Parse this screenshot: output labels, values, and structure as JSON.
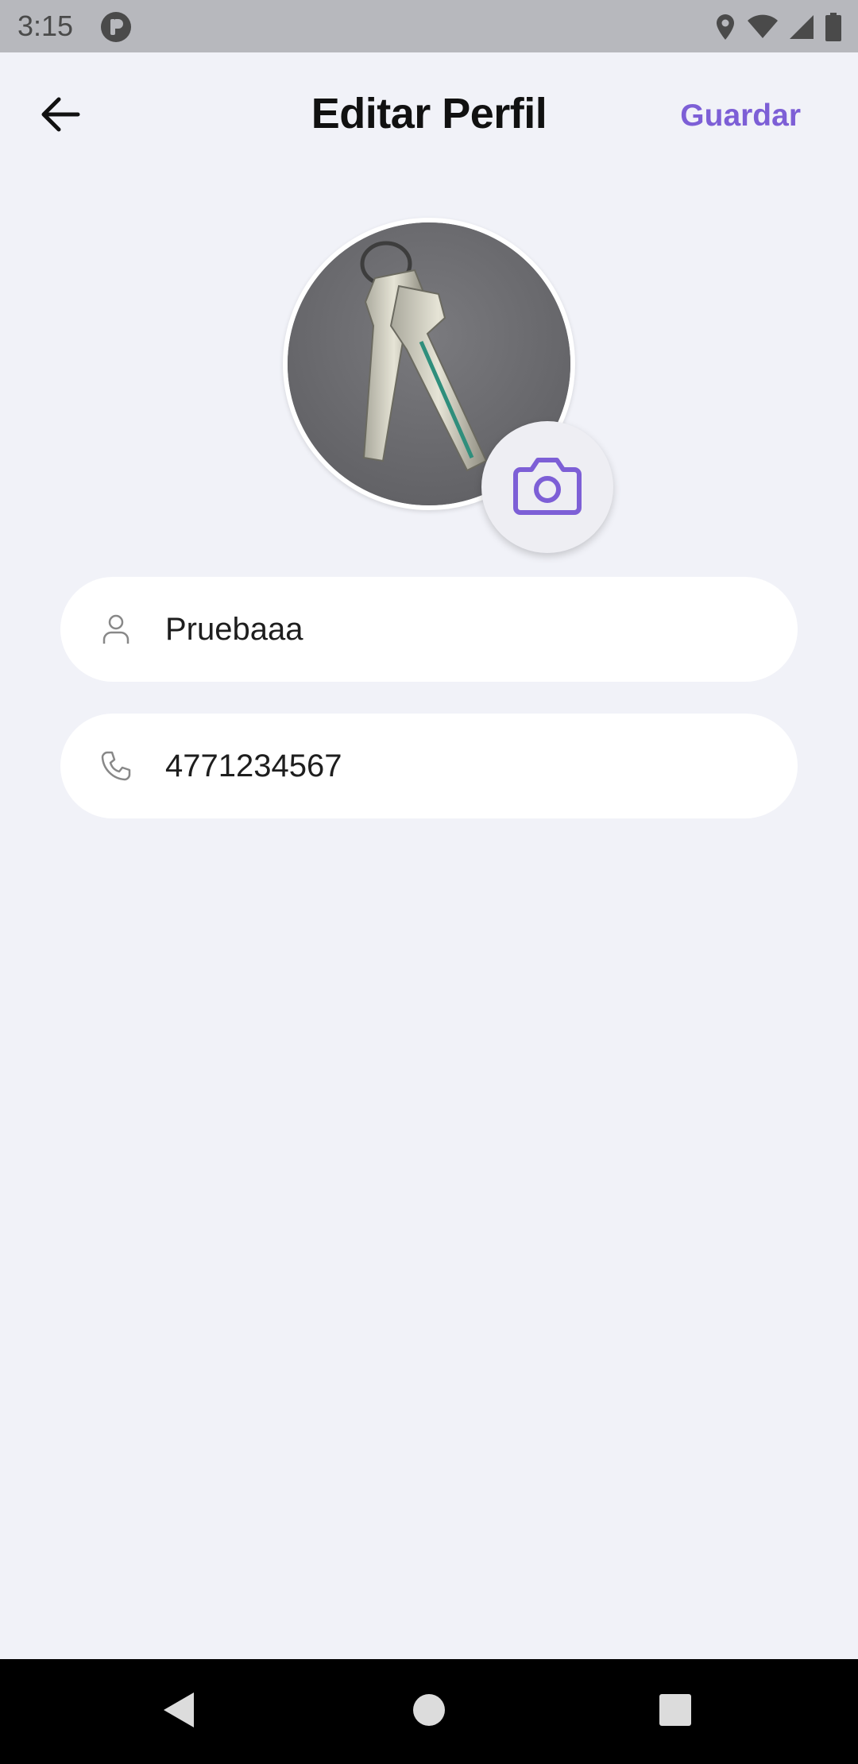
{
  "status_bar": {
    "time": "3:15",
    "icons": [
      "app-notification-icon",
      "location-icon",
      "wifi-icon",
      "signal-icon",
      "battery-icon"
    ]
  },
  "header": {
    "title": "Editar Perfil",
    "save_label": "Guardar",
    "back_icon": "arrow-left-icon"
  },
  "profile": {
    "avatar_description": "profile photo",
    "camera_icon": "camera-icon"
  },
  "form": {
    "name_value": "Pruebaaa",
    "name_icon": "user-icon",
    "phone_value": "4771234567",
    "phone_icon": "phone-icon"
  },
  "navigation": {
    "back_icon": "nav-back-icon",
    "home_icon": "nav-home-icon",
    "recents_icon": "nav-recents-icon"
  },
  "colors": {
    "accent": "#7d5fd6",
    "background": "#f1f2f8",
    "field_background": "#ffffff",
    "status_bar": "#b7b8bd"
  }
}
